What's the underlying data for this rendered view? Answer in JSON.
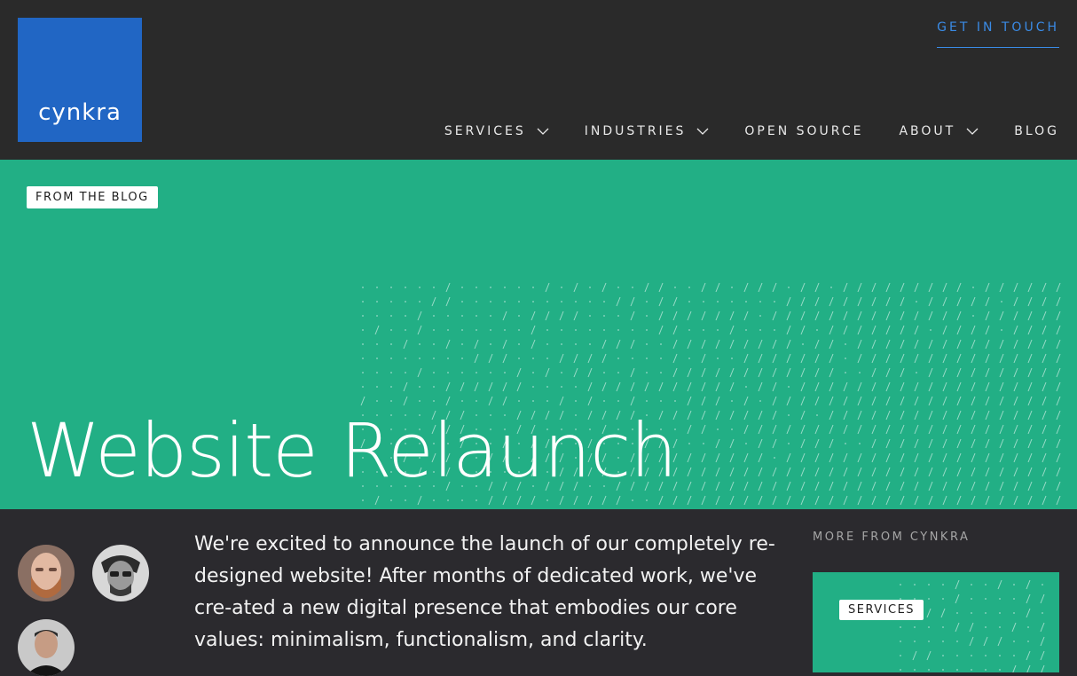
{
  "header": {
    "logo_text": "cynkra",
    "cta_label": "GET IN TOUCH",
    "nav": [
      {
        "label": "SERVICES",
        "has_dropdown": true
      },
      {
        "label": "INDUSTRIES",
        "has_dropdown": true
      },
      {
        "label": "OPEN SOURCE",
        "has_dropdown": false
      },
      {
        "label": "ABOUT",
        "has_dropdown": true
      },
      {
        "label": "BLOG",
        "has_dropdown": false
      }
    ]
  },
  "hero": {
    "tag": "FROM THE BLOG",
    "title": "Website Relaunch"
  },
  "article": {
    "lead": "We're excited to announce the launch of our completely re-designed website! After months of dedicated work, we've cre-ated a new digital presence that embodies our core values: minimalism, functionalism, and clarity."
  },
  "sidebar": {
    "heading": "MORE FROM CYNKRA",
    "card_tag": "SERVICES"
  },
  "colors": {
    "brand_blue": "#2166c4",
    "brand_green": "#22af85",
    "dark": "#2b2a2e",
    "link_blue": "#3a8be6"
  }
}
